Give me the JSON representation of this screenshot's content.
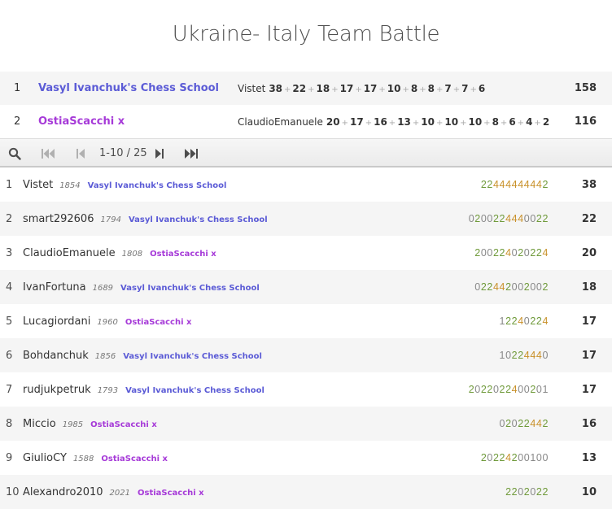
{
  "title": "Ukraine- Italy Team Battle",
  "colors": {
    "team_a": "#5b5bd6",
    "team_b": "#a63ad8",
    "win": "#6f9a3a",
    "streak": "#c9912a",
    "zero": "#888888"
  },
  "teams": [
    {
      "rank": "1",
      "name": "Vasyl Ivanchuk's Chess School",
      "color": "#5b5bd6",
      "leader": "Vistet",
      "points": [
        "38",
        "22",
        "18",
        "17",
        "17",
        "10",
        "8",
        "8",
        "7",
        "7",
        "6"
      ],
      "score": "158"
    },
    {
      "rank": "2",
      "name": "OstiaScacchi x",
      "color": "#a63ad8",
      "leader": "ClaudioEmanuele",
      "points": [
        "20",
        "17",
        "16",
        "13",
        "10",
        "10",
        "10",
        "8",
        "6",
        "4",
        "2"
      ],
      "score": "116"
    }
  ],
  "pager": {
    "search_icon": "search-icon",
    "first_icon": "first-page-icon",
    "prev_icon": "prev-page-icon",
    "next_icon": "next-page-icon",
    "last_icon": "last-page-icon",
    "label": "1-10 / 25"
  },
  "players": [
    {
      "rank": "1",
      "name": "Vistet",
      "rating": "1854",
      "team": "Vasyl Ivanchuk's Chess School",
      "team_color": "#5b5bd6",
      "sheet": "22444444442",
      "score": "38"
    },
    {
      "rank": "2",
      "name": "smart292606",
      "rating": "1794",
      "team": "Vasyl Ivanchuk's Chess School",
      "team_color": "#5b5bd6",
      "sheet": "0200224440022",
      "score": "22"
    },
    {
      "rank": "3",
      "name": "ClaudioEmanuele",
      "rating": "1808",
      "team": "OstiaScacchi x",
      "team_color": "#a63ad8",
      "sheet": "200224020224",
      "score": "20"
    },
    {
      "rank": "4",
      "name": "IvanFortuna",
      "rating": "1689",
      "team": "Vasyl Ivanchuk's Chess School",
      "team_color": "#5b5bd6",
      "sheet": "022442002002",
      "score": "18"
    },
    {
      "rank": "5",
      "name": "Lucagiordani",
      "rating": "1960",
      "team": "OstiaScacchi x",
      "team_color": "#a63ad8",
      "sheet": "1224O224",
      "score": "17"
    },
    {
      "rank": "6",
      "name": "Bohdanchuk",
      "rating": "1856",
      "team": "Vasyl Ivanchuk's Chess School",
      "team_color": "#5b5bd6",
      "sheet": "10224440",
      "score": "17"
    },
    {
      "rank": "7",
      "name": "rudjukpetruk",
      "rating": "1793",
      "team": "Vasyl Ivanchuk's Chess School",
      "team_color": "#5b5bd6",
      "sheet": "20220224OO2O1",
      "score": "17"
    },
    {
      "rank": "8",
      "name": "Miccio",
      "rating": "1985",
      "team": "OstiaScacchi x",
      "team_color": "#a63ad8",
      "sheet": "02022442",
      "score": "16"
    },
    {
      "rank": "9",
      "name": "GiulioCY",
      "rating": "1588",
      "team": "OstiaScacchi x",
      "team_color": "#a63ad8",
      "sheet": "20224200100",
      "score": "13"
    },
    {
      "rank": "10",
      "name": "Alexandro2010",
      "rating": "2021",
      "team": "OstiaScacchi x",
      "team_color": "#a63ad8",
      "sheet": "2202022",
      "score": "10"
    }
  ]
}
